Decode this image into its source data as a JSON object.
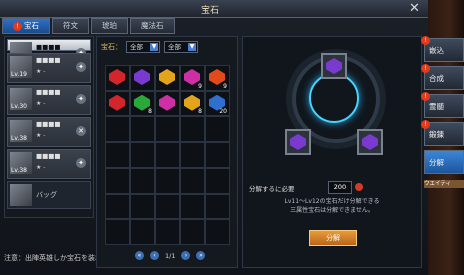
{
  "title": "宝石",
  "tabs": [
    {
      "label": "宝石",
      "alert": "!"
    },
    {
      "label": "符文"
    },
    {
      "label": "琥珀"
    },
    {
      "label": "魔法石"
    }
  ],
  "heroes": [
    {
      "name": "■■■■",
      "level": "",
      "stars": "★ -"
    },
    {
      "name": "■■■■",
      "level": "Lv.19",
      "stars": "★ -"
    },
    {
      "name": "■■■■",
      "level": "Lv.30",
      "stars": "★ -"
    },
    {
      "name": "■■■■",
      "level": "Lv.38",
      "stars": "★ -"
    },
    {
      "name": "■■■■",
      "level": "Lv.38",
      "stars": "★ -"
    },
    {
      "name": "■■■■",
      "level": "Lv.38",
      "stars": "★ -"
    }
  ],
  "bag_label": "バッグ",
  "notice": "注意：出陣英雄しか宝石を装着で",
  "filter": {
    "label": "宝石：",
    "opt1": "全部",
    "opt2": "全部"
  },
  "gems": [
    {
      "color": "#d2262a",
      "count": ""
    },
    {
      "color": "#7a3ad0",
      "count": ""
    },
    {
      "color": "#e3a31a",
      "count": ""
    },
    {
      "color": "#cf2fa4",
      "count": "9"
    },
    {
      "color": "#e34a1a",
      "count": "9"
    },
    {
      "color": "#d2262a",
      "count": ""
    },
    {
      "color": "#2aa83a",
      "count": "8"
    },
    {
      "color": "#cf2fa4",
      "count": ""
    },
    {
      "color": "#e3a31a",
      "count": "8"
    },
    {
      "color": "#2f6fd0",
      "count": "20"
    }
  ],
  "page": "1/1",
  "craft": {
    "split_label": "分解するに必要",
    "split_value": "200",
    "info1": "Lv11～Lv12の宝石だけ分解できる",
    "info2": "三属性宝石は分解できません。",
    "split_button": "分解"
  },
  "sidebar": [
    {
      "label": "嵌込"
    },
    {
      "label": "合成"
    },
    {
      "label": "霊髄"
    },
    {
      "label": "鍛錬"
    },
    {
      "label": "分解",
      "active": true
    }
  ],
  "side_strip": "ウエイティ"
}
